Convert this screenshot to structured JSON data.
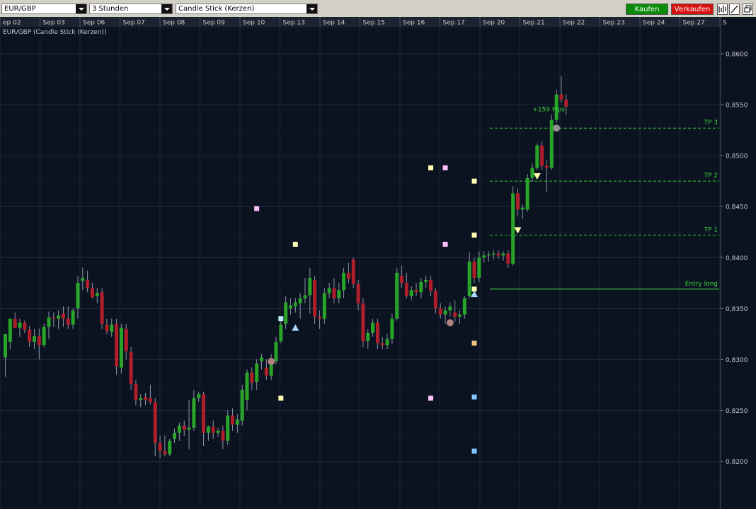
{
  "toolbar": {
    "symbol": "EUR/GBP",
    "timeframe": "3 Stunden",
    "chart_type": "Candle Stick (Kerzen)",
    "buy_label": "Kaufen",
    "sell_label": "Verkaufen",
    "buy_color": "#0a8c0a",
    "sell_color": "#d81010",
    "tool_icons": [
      "bar-chart-icon",
      "draw-line-icon",
      "window-restore-icon"
    ]
  },
  "colors": {
    "background": "#0b1220",
    "grid": "#1e2a3e",
    "bull": "#28a428",
    "bear": "#b01e2a",
    "annotation": "#3cd23c",
    "axis_text": "#c8c8c8"
  },
  "chart_data": {
    "type": "candlestick",
    "title": "EUR/GBP (Candle Stick (Kerzen))",
    "date_labels": [
      "ep 02",
      "Sep 03",
      "Sep 06",
      "Sep 07",
      "Sep 08",
      "Sep 09",
      "Sep 10",
      "Sep 13",
      "Sep 14",
      "Sep 15",
      "Sep 16",
      "Sep 17",
      "Sep 20",
      "Sep 21",
      "Sep 22",
      "Sep 23",
      "Sep 24",
      "Sep 27",
      "S"
    ],
    "y_ticks": [
      "0,8200",
      "0,8250",
      "0,8300",
      "0,8350",
      "0,8400",
      "0,8450",
      "0,8500",
      "0,8550",
      "0,8600"
    ],
    "y_range": [
      0.817,
      0.8625
    ],
    "candles": [
      {
        "date": "Sep 02",
        "o": 0.8302,
        "h": 0.8312,
        "l": 0.8283,
        "c": 0.8325
      },
      {
        "date": "Sep 02",
        "o": 0.8317,
        "h": 0.8327,
        "l": 0.831,
        "c": 0.834
      },
      {
        "date": "Sep 02",
        "o": 0.834,
        "h": 0.8346,
        "l": 0.8331,
        "c": 0.8331
      },
      {
        "date": "Sep 02",
        "o": 0.8331,
        "h": 0.834,
        "l": 0.8322,
        "c": 0.8336
      },
      {
        "date": "Sep 02",
        "o": 0.8336,
        "h": 0.8338,
        "l": 0.8326,
        "c": 0.8329
      },
      {
        "date": "Sep 03",
        "o": 0.8329,
        "h": 0.8333,
        "l": 0.8312,
        "c": 0.8317
      },
      {
        "date": "Sep 03",
        "o": 0.8317,
        "h": 0.833,
        "l": 0.831,
        "c": 0.8323
      },
      {
        "date": "Sep 03",
        "o": 0.8323,
        "h": 0.833,
        "l": 0.83,
        "c": 0.8314
      },
      {
        "date": "Sep 03",
        "o": 0.8314,
        "h": 0.8335,
        "l": 0.8312,
        "c": 0.8332
      },
      {
        "date": "Sep 03",
        "o": 0.8332,
        "h": 0.8347,
        "l": 0.832,
        "c": 0.8341
      },
      {
        "date": "Sep 03",
        "o": 0.8341,
        "h": 0.8346,
        "l": 0.8332,
        "c": 0.834
      },
      {
        "date": "Sep 03",
        "o": 0.834,
        "h": 0.8348,
        "l": 0.833,
        "c": 0.8343
      },
      {
        "date": "Sep 06",
        "o": 0.8345,
        "h": 0.8352,
        "l": 0.8332,
        "c": 0.834
      },
      {
        "date": "Sep 06",
        "o": 0.834,
        "h": 0.8352,
        "l": 0.833,
        "c": 0.8334
      },
      {
        "date": "Sep 06",
        "o": 0.8334,
        "h": 0.835,
        "l": 0.833,
        "c": 0.8348
      },
      {
        "date": "Sep 06",
        "o": 0.835,
        "h": 0.8382,
        "l": 0.834,
        "c": 0.8375
      },
      {
        "date": "Sep 06",
        "o": 0.8377,
        "h": 0.839,
        "l": 0.8368,
        "c": 0.838
      },
      {
        "date": "Sep 06",
        "o": 0.8378,
        "h": 0.8387,
        "l": 0.8366,
        "c": 0.837
      },
      {
        "date": "Sep 06",
        "o": 0.837,
        "h": 0.8375,
        "l": 0.836,
        "c": 0.8361
      },
      {
        "date": "Sep 07",
        "o": 0.8362,
        "h": 0.837,
        "l": 0.8355,
        "c": 0.8365
      },
      {
        "date": "Sep 07",
        "o": 0.8366,
        "h": 0.837,
        "l": 0.833,
        "c": 0.8335
      },
      {
        "date": "Sep 07",
        "o": 0.8334,
        "h": 0.834,
        "l": 0.8325,
        "c": 0.8328
      },
      {
        "date": "Sep 07",
        "o": 0.8327,
        "h": 0.834,
        "l": 0.8322,
        "c": 0.8334
      },
      {
        "date": "Sep 07",
        "o": 0.8335,
        "h": 0.834,
        "l": 0.8285,
        "c": 0.8293
      },
      {
        "date": "Sep 07",
        "o": 0.8292,
        "h": 0.8335,
        "l": 0.8286,
        "c": 0.8331
      },
      {
        "date": "Sep 08",
        "o": 0.833,
        "h": 0.8335,
        "l": 0.83,
        "c": 0.8308
      },
      {
        "date": "Sep 08",
        "o": 0.8307,
        "h": 0.8312,
        "l": 0.827,
        "c": 0.8276
      },
      {
        "date": "Sep 08",
        "o": 0.8276,
        "h": 0.828,
        "l": 0.8255,
        "c": 0.826
      },
      {
        "date": "Sep 08",
        "o": 0.826,
        "h": 0.8266,
        "l": 0.8253,
        "c": 0.8262
      },
      {
        "date": "Sep 08",
        "o": 0.8263,
        "h": 0.8267,
        "l": 0.8255,
        "c": 0.826
      },
      {
        "date": "Sep 08",
        "o": 0.8262,
        "h": 0.8275,
        "l": 0.8256,
        "c": 0.8258
      },
      {
        "date": "Sep 08",
        "o": 0.8258,
        "h": 0.8262,
        "l": 0.8205,
        "c": 0.8218
      },
      {
        "date": "Sep 09",
        "o": 0.8218,
        "h": 0.8225,
        "l": 0.8203,
        "c": 0.821
      },
      {
        "date": "Sep 09",
        "o": 0.821,
        "h": 0.8225,
        "l": 0.8205,
        "c": 0.8207
      },
      {
        "date": "Sep 09",
        "o": 0.8207,
        "h": 0.8222,
        "l": 0.8205,
        "c": 0.822
      },
      {
        "date": "Sep 09",
        "o": 0.8222,
        "h": 0.8232,
        "l": 0.8218,
        "c": 0.8228
      },
      {
        "date": "Sep 09",
        "o": 0.8228,
        "h": 0.8238,
        "l": 0.822,
        "c": 0.8235
      },
      {
        "date": "Sep 09",
        "o": 0.8235,
        "h": 0.824,
        "l": 0.8225,
        "c": 0.8231
      },
      {
        "date": "Sep 09",
        "o": 0.8231,
        "h": 0.826,
        "l": 0.8212,
        "c": 0.8233
      },
      {
        "date": "Sep 09",
        "o": 0.8233,
        "h": 0.827,
        "l": 0.823,
        "c": 0.8262
      },
      {
        "date": "Sep 09",
        "o": 0.8262,
        "h": 0.8268,
        "l": 0.8258,
        "c": 0.8266
      },
      {
        "date": "Sep 10",
        "o": 0.8266,
        "h": 0.8268,
        "l": 0.8215,
        "c": 0.8228
      },
      {
        "date": "Sep 10",
        "o": 0.8228,
        "h": 0.8235,
        "l": 0.822,
        "c": 0.8234
      },
      {
        "date": "Sep 10",
        "o": 0.8234,
        "h": 0.824,
        "l": 0.8222,
        "c": 0.8228
      },
      {
        "date": "Sep 10",
        "o": 0.8228,
        "h": 0.8233,
        "l": 0.8224,
        "c": 0.823
      },
      {
        "date": "Sep 10",
        "o": 0.823,
        "h": 0.8235,
        "l": 0.8212,
        "c": 0.822
      },
      {
        "date": "Sep 10",
        "o": 0.822,
        "h": 0.825,
        "l": 0.8216,
        "c": 0.8245
      },
      {
        "date": "Sep 10",
        "o": 0.8245,
        "h": 0.8252,
        "l": 0.823,
        "c": 0.8236
      },
      {
        "date": "Sep 10",
        "o": 0.8236,
        "h": 0.8246,
        "l": 0.8228,
        "c": 0.8241
      },
      {
        "date": "Sep 10",
        "o": 0.824,
        "h": 0.8275,
        "l": 0.8235,
        "c": 0.827
      },
      {
        "date": "Sep 13",
        "o": 0.826,
        "h": 0.829,
        "l": 0.825,
        "c": 0.8287
      },
      {
        "date": "Sep 13",
        "o": 0.8287,
        "h": 0.8292,
        "l": 0.827,
        "c": 0.8277
      },
      {
        "date": "Sep 13",
        "o": 0.8278,
        "h": 0.83,
        "l": 0.827,
        "c": 0.8296
      },
      {
        "date": "Sep 13",
        "o": 0.8298,
        "h": 0.8305,
        "l": 0.829,
        "c": 0.8302
      },
      {
        "date": "Sep 13",
        "o": 0.8292,
        "h": 0.83,
        "l": 0.828,
        "c": 0.8284
      },
      {
        "date": "Sep 13",
        "o": 0.8284,
        "h": 0.8305,
        "l": 0.828,
        "c": 0.8298
      },
      {
        "date": "Sep 13",
        "o": 0.8298,
        "h": 0.8322,
        "l": 0.8295,
        "c": 0.8317
      },
      {
        "date": "Sep 13",
        "o": 0.8318,
        "h": 0.834,
        "l": 0.8316,
        "c": 0.8334
      },
      {
        "date": "Sep 13",
        "o": 0.8335,
        "h": 0.8362,
        "l": 0.833,
        "c": 0.8356
      },
      {
        "date": "Sep 14",
        "o": 0.835,
        "h": 0.836,
        "l": 0.8344,
        "c": 0.8353
      },
      {
        "date": "Sep 14",
        "o": 0.8352,
        "h": 0.836,
        "l": 0.8346,
        "c": 0.8356
      },
      {
        "date": "Sep 14",
        "o": 0.8355,
        "h": 0.8365,
        "l": 0.834,
        "c": 0.836
      },
      {
        "date": "Sep 14",
        "o": 0.836,
        "h": 0.838,
        "l": 0.8355,
        "c": 0.8363
      },
      {
        "date": "Sep 14",
        "o": 0.8363,
        "h": 0.839,
        "l": 0.8345,
        "c": 0.838
      },
      {
        "date": "Sep 14",
        "o": 0.8378,
        "h": 0.8382,
        "l": 0.8335,
        "c": 0.8342
      },
      {
        "date": "Sep 14",
        "o": 0.8342,
        "h": 0.8348,
        "l": 0.833,
        "c": 0.834
      },
      {
        "date": "Sep 14",
        "o": 0.834,
        "h": 0.837,
        "l": 0.8335,
        "c": 0.8365
      },
      {
        "date": "Sep 15",
        "o": 0.8365,
        "h": 0.8375,
        "l": 0.836,
        "c": 0.837
      },
      {
        "date": "Sep 15",
        "o": 0.837,
        "h": 0.838,
        "l": 0.8355,
        "c": 0.836
      },
      {
        "date": "Sep 15",
        "o": 0.836,
        "h": 0.8375,
        "l": 0.8355,
        "c": 0.8368
      },
      {
        "date": "Sep 15",
        "o": 0.8368,
        "h": 0.839,
        "l": 0.836,
        "c": 0.8385
      },
      {
        "date": "Sep 15",
        "o": 0.8385,
        "h": 0.8395,
        "l": 0.8375,
        "c": 0.8379
      },
      {
        "date": "Sep 15",
        "o": 0.8398,
        "h": 0.84,
        "l": 0.837,
        "c": 0.8374
      },
      {
        "date": "Sep 15",
        "o": 0.8374,
        "h": 0.8378,
        "l": 0.8348,
        "c": 0.8355
      },
      {
        "date": "Sep 15",
        "o": 0.8355,
        "h": 0.836,
        "l": 0.8312,
        "c": 0.8318
      },
      {
        "date": "Sep 16",
        "o": 0.8318,
        "h": 0.833,
        "l": 0.831,
        "c": 0.8326
      },
      {
        "date": "Sep 16",
        "o": 0.8326,
        "h": 0.834,
        "l": 0.8322,
        "c": 0.8336
      },
      {
        "date": "Sep 16",
        "o": 0.8336,
        "h": 0.834,
        "l": 0.831,
        "c": 0.8316
      },
      {
        "date": "Sep 16",
        "o": 0.8316,
        "h": 0.8322,
        "l": 0.831,
        "c": 0.8314
      },
      {
        "date": "Sep 16",
        "o": 0.8314,
        "h": 0.8325,
        "l": 0.831,
        "c": 0.832
      },
      {
        "date": "Sep 16",
        "o": 0.832,
        "h": 0.8345,
        "l": 0.8315,
        "c": 0.834
      },
      {
        "date": "Sep 16",
        "o": 0.834,
        "h": 0.839,
        "l": 0.8338,
        "c": 0.8385
      },
      {
        "date": "Sep 16",
        "o": 0.8382,
        "h": 0.8392,
        "l": 0.837,
        "c": 0.8375
      },
      {
        "date": "Sep 17",
        "o": 0.8375,
        "h": 0.8385,
        "l": 0.836,
        "c": 0.8362
      },
      {
        "date": "Sep 17",
        "o": 0.8362,
        "h": 0.8372,
        "l": 0.8358,
        "c": 0.8368
      },
      {
        "date": "Sep 17",
        "o": 0.8368,
        "h": 0.8375,
        "l": 0.8362,
        "c": 0.8366
      },
      {
        "date": "Sep 17",
        "o": 0.8366,
        "h": 0.838,
        "l": 0.836,
        "c": 0.8376
      },
      {
        "date": "Sep 17",
        "o": 0.8376,
        "h": 0.8382,
        "l": 0.837,
        "c": 0.8378
      },
      {
        "date": "Sep 17",
        "o": 0.8378,
        "h": 0.8382,
        "l": 0.8362,
        "c": 0.8367
      },
      {
        "date": "Sep 17",
        "o": 0.8367,
        "h": 0.837,
        "l": 0.8345,
        "c": 0.835
      },
      {
        "date": "Sep 17",
        "o": 0.835,
        "h": 0.8355,
        "l": 0.834,
        "c": 0.8344
      },
      {
        "date": "Sep 17",
        "o": 0.8344,
        "h": 0.8352,
        "l": 0.8335,
        "c": 0.8348
      },
      {
        "date": "Sep 17",
        "o": 0.8348,
        "h": 0.8356,
        "l": 0.8342,
        "c": 0.8352
      },
      {
        "date": "Sep 20",
        "o": 0.8346,
        "h": 0.8358,
        "l": 0.8337,
        "c": 0.8342
      },
      {
        "date": "Sep 20",
        "o": 0.8342,
        "h": 0.8348,
        "l": 0.8335,
        "c": 0.8344
      },
      {
        "date": "Sep 20",
        "o": 0.8344,
        "h": 0.8362,
        "l": 0.834,
        "c": 0.836
      },
      {
        "date": "Sep 20",
        "o": 0.8362,
        "h": 0.8405,
        "l": 0.836,
        "c": 0.8396
      },
      {
        "date": "Sep 20",
        "o": 0.8396,
        "h": 0.84,
        "l": 0.8375,
        "c": 0.838
      },
      {
        "date": "Sep 20",
        "o": 0.838,
        "h": 0.8406,
        "l": 0.8376,
        "c": 0.84
      },
      {
        "date": "Sep 20",
        "o": 0.84,
        "h": 0.8406,
        "l": 0.8395,
        "c": 0.8402
      },
      {
        "date": "Sep 20",
        "o": 0.8402,
        "h": 0.8406,
        "l": 0.8396,
        "c": 0.8403
      },
      {
        "date": "Sep 21",
        "o": 0.8403,
        "h": 0.8407,
        "l": 0.8398,
        "c": 0.8404
      },
      {
        "date": "Sep 21",
        "o": 0.8404,
        "h": 0.8407,
        "l": 0.8399,
        "c": 0.8402
      },
      {
        "date": "Sep 21",
        "o": 0.8402,
        "h": 0.8406,
        "l": 0.8397,
        "c": 0.8404
      },
      {
        "date": "Sep 21",
        "o": 0.8404,
        "h": 0.8407,
        "l": 0.839,
        "c": 0.8394
      },
      {
        "date": "Sep 21",
        "o": 0.8394,
        "h": 0.847,
        "l": 0.8392,
        "c": 0.8463
      },
      {
        "date": "Sep 21",
        "o": 0.8463,
        "h": 0.8468,
        "l": 0.844,
        "c": 0.8447
      },
      {
        "date": "Sep 21",
        "o": 0.8447,
        "h": 0.8452,
        "l": 0.8438,
        "c": 0.8449
      },
      {
        "date": "Sep 21",
        "o": 0.8447,
        "h": 0.8482,
        "l": 0.8445,
        "c": 0.8478
      },
      {
        "date": "Sep 22",
        "o": 0.8478,
        "h": 0.8492,
        "l": 0.8474,
        "c": 0.8488
      },
      {
        "date": "Sep 22",
        "o": 0.8488,
        "h": 0.8512,
        "l": 0.8486,
        "c": 0.851
      },
      {
        "date": "Sep 22",
        "o": 0.851,
        "h": 0.8514,
        "l": 0.8486,
        "c": 0.849
      },
      {
        "date": "Sep 22",
        "o": 0.849,
        "h": 0.8496,
        "l": 0.8464,
        "c": 0.8488
      },
      {
        "date": "Sep 22",
        "o": 0.8488,
        "h": 0.854,
        "l": 0.8486,
        "c": 0.8535
      },
      {
        "date": "Sep 22",
        "o": 0.8535,
        "h": 0.8565,
        "l": 0.8532,
        "c": 0.856
      },
      {
        "date": "Sep 22",
        "o": 0.856,
        "h": 0.8578,
        "l": 0.8552,
        "c": 0.8555
      },
      {
        "date": "Sep 22",
        "o": 0.8555,
        "h": 0.856,
        "l": 0.854,
        "c": 0.8548
      }
    ],
    "markers": [
      {
        "type": "square",
        "color": "#ffc0ff",
        "i": 52,
        "price": 0.8448
      },
      {
        "type": "square",
        "color": "#ffffb0",
        "i": 60,
        "price": 0.8413
      },
      {
        "type": "square",
        "color": "#c0ecff",
        "i": 57,
        "price": 0.834
      },
      {
        "type": "square",
        "color": "#ffffb0",
        "i": 57,
        "price": 0.8262
      },
      {
        "type": "square",
        "color": "#ffffb0",
        "i": 88,
        "price": 0.8488
      },
      {
        "type": "square",
        "color": "#ffc0ff",
        "i": 91,
        "price": 0.8488
      },
      {
        "type": "square",
        "color": "#ffc0ff",
        "i": 91,
        "price": 0.8413
      },
      {
        "type": "square",
        "color": "#ffc0ff",
        "i": 88,
        "price": 0.8262
      },
      {
        "type": "square",
        "color": "#ffffb0",
        "i": 97,
        "price": 0.8475
      },
      {
        "type": "square",
        "color": "#ffffb0",
        "i": 97,
        "price": 0.8422
      },
      {
        "type": "square",
        "color": "#ffffb0",
        "i": 97,
        "price": 0.8369
      },
      {
        "type": "square",
        "color": "#f5c080",
        "i": 97,
        "price": 0.8316
      },
      {
        "type": "square",
        "color": "#80c8ff",
        "i": 97,
        "price": 0.8263
      },
      {
        "type": "square",
        "color": "#80c8ff",
        "i": 97,
        "price": 0.821
      },
      {
        "type": "circle",
        "color": "#b08080",
        "i": 55,
        "price": 0.8298
      },
      {
        "type": "circle",
        "color": "#b08080",
        "i": 92,
        "price": 0.8336
      },
      {
        "type": "circle",
        "color": "#909090",
        "i": 114,
        "price": 0.8527
      },
      {
        "type": "triangle-up",
        "color": "#a8d8ff",
        "i": 60,
        "price": 0.8331
      },
      {
        "type": "triangle-up",
        "color": "#a8d8ff",
        "i": 97,
        "price": 0.8364
      },
      {
        "type": "triangle-down",
        "color": "#ffffb0",
        "i": 106,
        "price": 0.8427
      },
      {
        "type": "triangle-down",
        "color": "#ffffb0",
        "i": 110,
        "price": 0.848
      }
    ],
    "levels": [
      {
        "label": "TP 3",
        "price": 0.8527,
        "style": "dashed"
      },
      {
        "label": "TP 2",
        "price": 0.8475,
        "style": "dashed"
      },
      {
        "label": "TP 1",
        "price": 0.8422,
        "style": "dashed"
      },
      {
        "label": "Entry long",
        "price": 0.8369,
        "style": "solid"
      }
    ],
    "annotation": {
      "text": "+159 Pips",
      "price": 0.8542
    }
  }
}
